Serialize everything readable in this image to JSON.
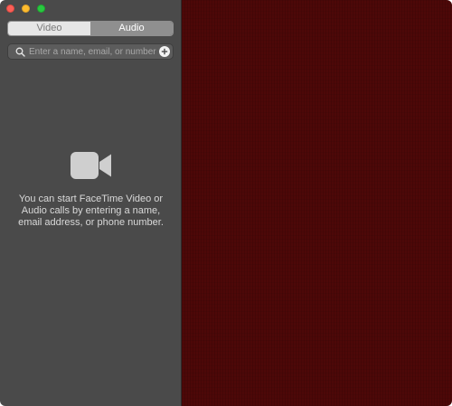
{
  "window": {
    "controls": [
      "close",
      "minimize",
      "zoom"
    ]
  },
  "mode_toggle": {
    "video_label": "Video",
    "audio_label": "Audio",
    "selected": "Audio"
  },
  "search": {
    "placeholder": "Enter a name, email, or number",
    "value": "",
    "search_icon": "search-icon",
    "add_icon": "plus-circle-icon"
  },
  "empty_state": {
    "icon": "video-camera-icon",
    "message": "You can start FaceTime Video or Audio calls by entering a name, email address, or phone number."
  },
  "colors": {
    "sidebar_bg": "#4a4a4a",
    "camera_bg": "#4d0808",
    "close": "#fc5f57",
    "minimize": "#fdbc2e",
    "zoom": "#29c840"
  }
}
